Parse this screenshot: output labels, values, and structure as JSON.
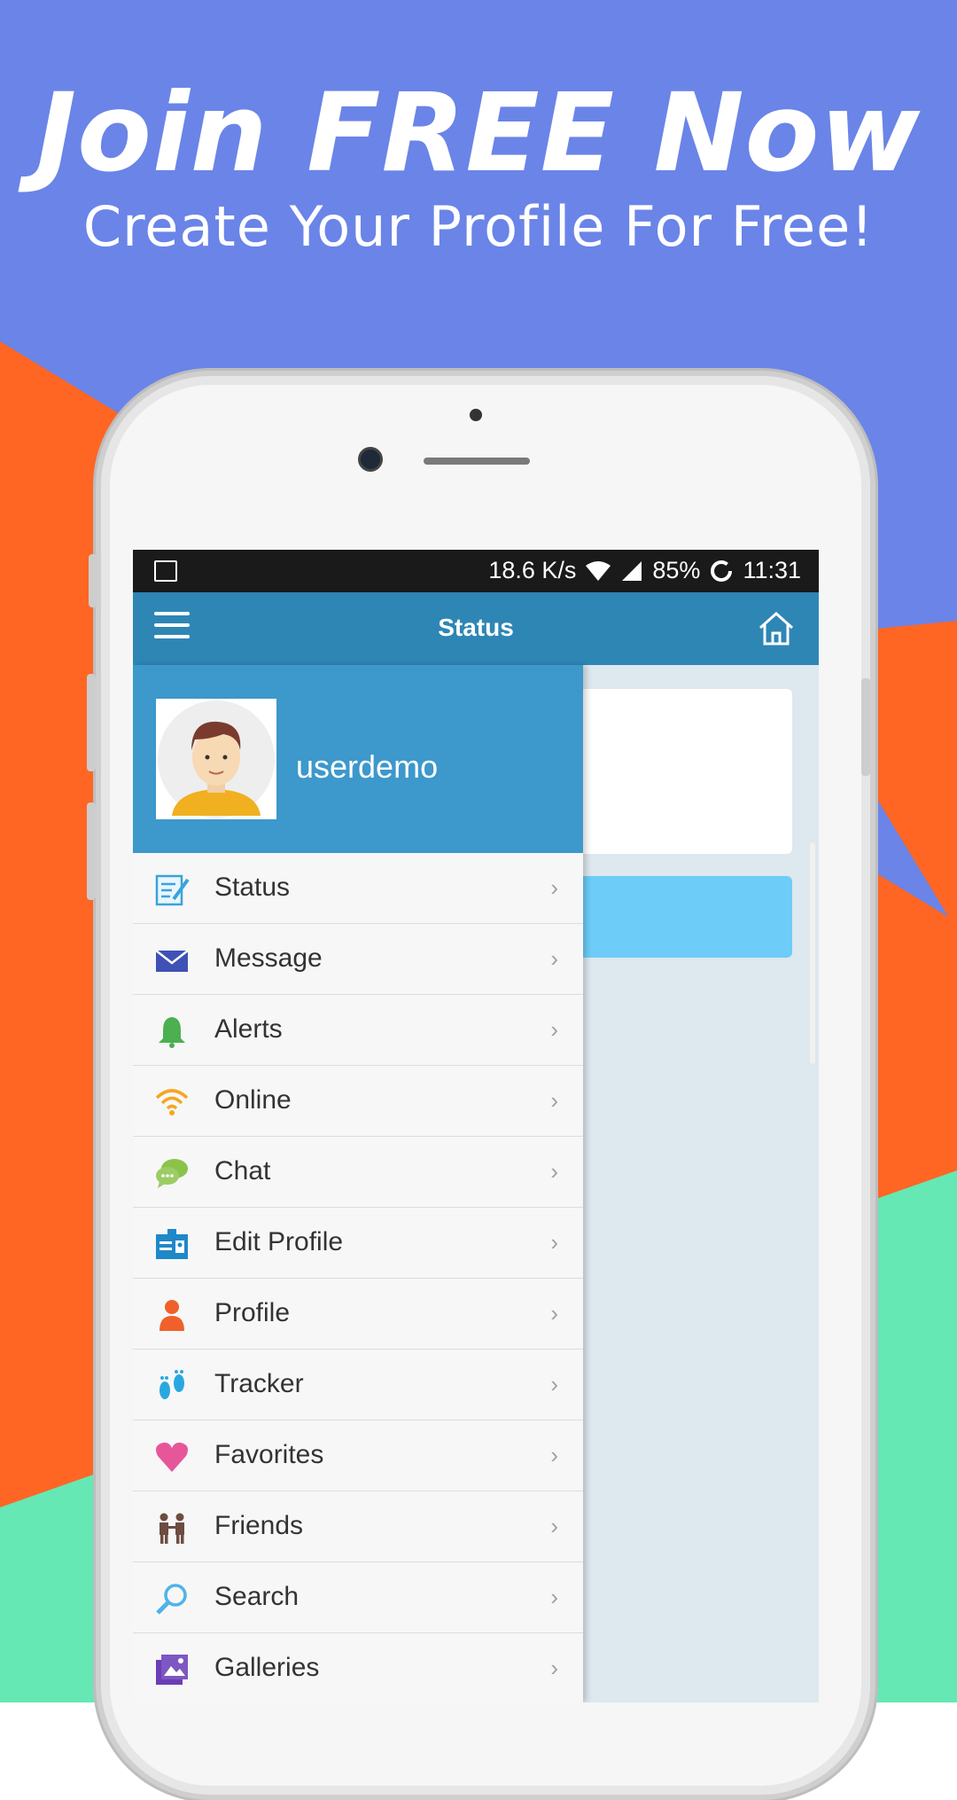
{
  "promo": {
    "headline": "Join FREE Now",
    "subheadline": "Create Your Profile For Free!",
    "colors": {
      "blue": "#6a84e8",
      "orange": "#ff6624",
      "green": "#65e8b4"
    }
  },
  "statusbar": {
    "speed": "18.6 K/s",
    "battery": "85%",
    "time": "11:31",
    "icons": [
      "image-icon",
      "wifi-icon",
      "signal-icon",
      "battery-ring-icon"
    ]
  },
  "appbar": {
    "title": "Status",
    "icons": [
      "hamburger-menu-icon",
      "home-icon"
    ]
  },
  "drawer": {
    "username": "userdemo",
    "items": [
      {
        "label": "Status",
        "icon": "status-edit-icon"
      },
      {
        "label": "Message",
        "icon": "envelope-icon"
      },
      {
        "label": "Alerts",
        "icon": "bell-icon"
      },
      {
        "label": "Online",
        "icon": "wifi-icon"
      },
      {
        "label": "Chat",
        "icon": "chat-bubbles-icon"
      },
      {
        "label": "Edit Profile",
        "icon": "id-card-icon"
      },
      {
        "label": "Profile",
        "icon": "person-icon"
      },
      {
        "label": "Tracker",
        "icon": "footprints-icon"
      },
      {
        "label": "Favorites",
        "icon": "heart-icon"
      },
      {
        "label": "Friends",
        "icon": "friends-icon"
      },
      {
        "label": "Search",
        "icon": "magnifier-icon"
      },
      {
        "label": "Galleries",
        "icon": "gallery-icon"
      }
    ],
    "chevron": "›"
  }
}
